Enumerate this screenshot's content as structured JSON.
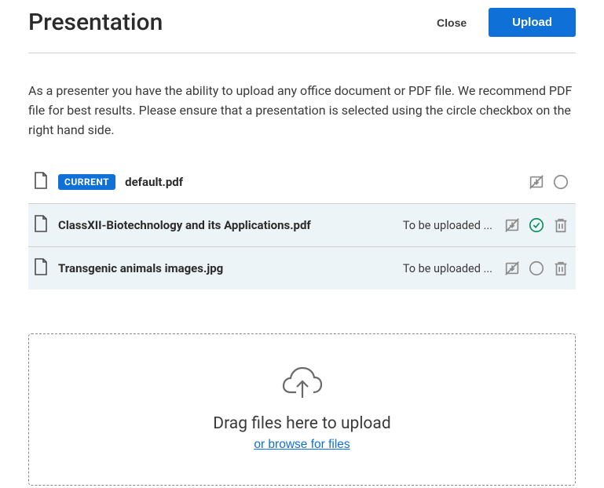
{
  "header": {
    "title": "Presentation",
    "close_label": "Close",
    "upload_label": "Upload"
  },
  "description": "As a presenter you have the ability to upload any office document or PDF file. We recommend PDF file for best results. Please ensure that a presentation is selected using the circle checkbox on the right hand side.",
  "badges": {
    "current": "CURRENT"
  },
  "files": [
    {
      "name": "default.pdf",
      "status": "",
      "current": true,
      "queued": false,
      "selected": false,
      "deletable": false
    },
    {
      "name": "ClassXII-Biotechnology and its Applications.pdf",
      "status": "To be uploaded ...",
      "current": false,
      "queued": true,
      "selected": true,
      "deletable": true
    },
    {
      "name": "Transgenic animals images.jpg",
      "status": "To be uploaded ...",
      "current": false,
      "queued": true,
      "selected": false,
      "deletable": true
    }
  ],
  "dropzone": {
    "drag_text": "Drag files here to upload",
    "browse_text": "or browse for files"
  },
  "icons": {
    "file": "file-icon",
    "download_disabled": "download-disabled-icon",
    "select_circle": "select-circle-icon",
    "select_check": "select-check-icon",
    "trash": "trash-icon",
    "cloud_upload": "cloud-upload-icon"
  },
  "colors": {
    "primary": "#0f70d7",
    "success": "#0a8f5b",
    "muted": "#8b8b8b",
    "queued_bg": "#edf4f7"
  }
}
